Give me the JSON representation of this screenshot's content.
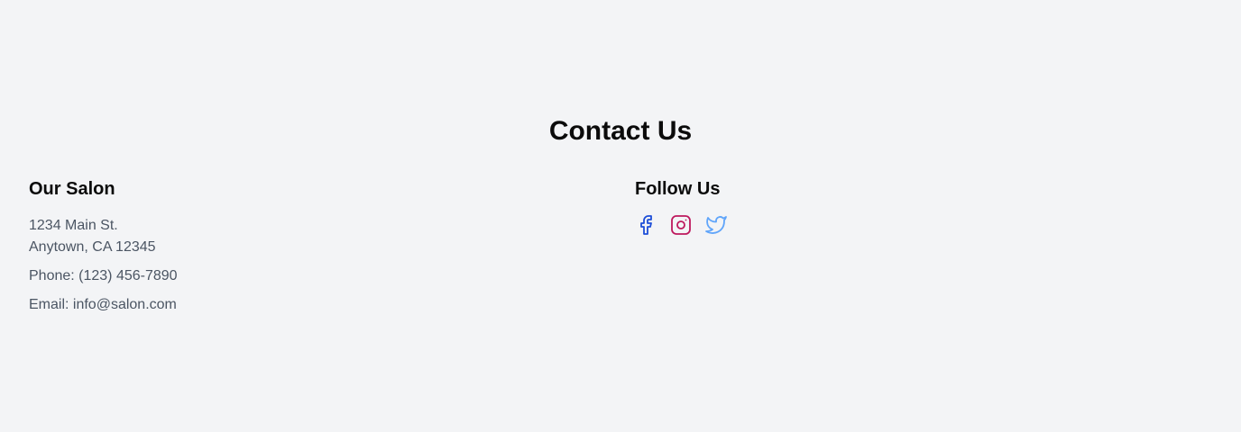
{
  "contact": {
    "title": "Contact Us",
    "salon": {
      "heading": "Our Salon",
      "address_line1": "1234 Main St.",
      "address_line2": "Anytown, CA 12345",
      "phone": "Phone: (123) 456-7890",
      "email": "Email: info@salon.com"
    },
    "follow": {
      "heading": "Follow Us",
      "icons": [
        {
          "name": "facebook-icon",
          "color": "#1d4ed8"
        },
        {
          "name": "instagram-icon",
          "color": "#be185d"
        },
        {
          "name": "twitter-icon",
          "color": "#60a5fa"
        }
      ]
    }
  },
  "colors": {
    "background": "#f3f4f6",
    "heading": "#0b0b0b",
    "body_text": "#4b5563"
  }
}
